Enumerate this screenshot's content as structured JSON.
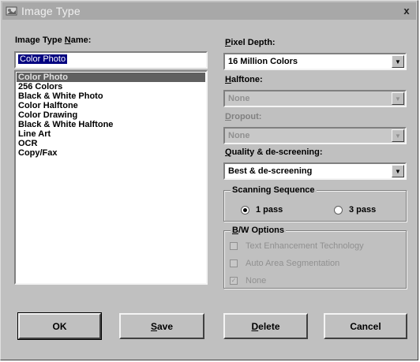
{
  "window": {
    "title": "Image Type",
    "close": "x",
    "icon": "image-type-icon"
  },
  "left": {
    "name_label": "Image Type Name:",
    "name_value": "Color Photo",
    "list": [
      "Color Photo",
      "256 Colors",
      "Black & White Photo",
      "Color Halftone",
      "Color Drawing",
      "Black & White Halftone",
      "Line Art",
      "OCR",
      "Copy/Fax"
    ],
    "selected_index": 0
  },
  "right": {
    "pixel_depth_label": "Pixel Depth:",
    "pixel_depth_value": "16 Million Colors",
    "halftone_label": "Halftone:",
    "halftone_value": "None",
    "dropout_label": "Dropout:",
    "dropout_value": "None",
    "quality_label": "Quality & de-screening:",
    "quality_value": "Best & de-screening",
    "scanning": {
      "title": "Scanning Sequence",
      "opt1": "1 pass",
      "opt2": "3 pass",
      "selected": "1 pass"
    },
    "bw": {
      "title": "B/W Options",
      "opt1": "Text Enhancement Technology",
      "opt2": "Auto Area Segmentation",
      "opt3": "None"
    }
  },
  "buttons": {
    "ok": "OK",
    "save": "Save",
    "delete": "Delete",
    "cancel": "Cancel"
  },
  "colors": {
    "face": "#c0c0c0",
    "titlebar": "#a8a8a8",
    "selection": "#606060"
  }
}
